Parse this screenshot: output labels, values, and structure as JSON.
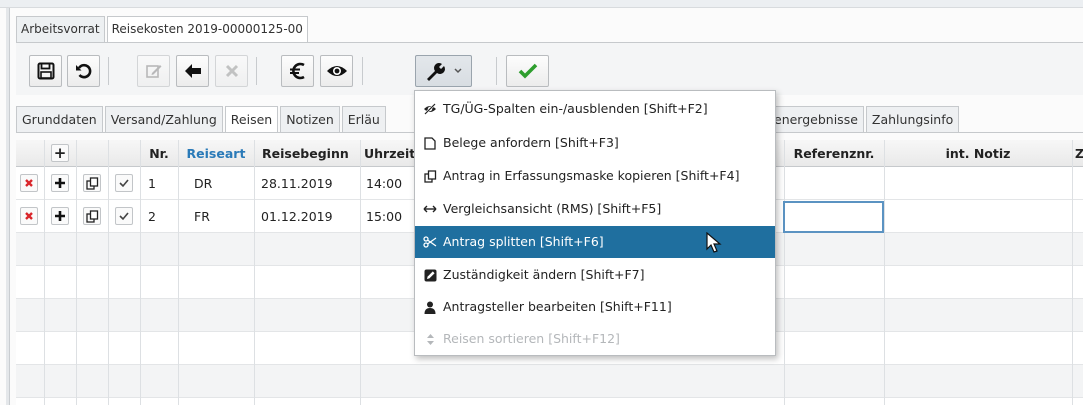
{
  "document_tabs": [
    {
      "label": "Arbeitsvorrat",
      "active": false
    },
    {
      "label": "Reisekosten 2019-00000125-00",
      "active": true
    }
  ],
  "toolbar": {
    "buttons": [
      "save-icon",
      "undo-icon",
      "edit-icon",
      "back-arrow-icon",
      "cancel-icon",
      "euro-icon",
      "eye-icon",
      "wrench-dropdown-icon",
      "confirm-check-icon"
    ],
    "accent_check": "#2e9e2e"
  },
  "detail_tabs": [
    {
      "label": "Grunddaten"
    },
    {
      "label": "Versand/Zahlung"
    },
    {
      "label": "Reisen",
      "active": true
    },
    {
      "label": "Notizen"
    },
    {
      "label": "Erläu"
    },
    {
      "label": "energebnisse"
    },
    {
      "label": "Zahlungsinfo"
    }
  ],
  "grid": {
    "headers": {
      "add": "+",
      "nr": "Nr.",
      "reiseart": "Reiseart",
      "reisebeginn": "Reisebeginn",
      "uhrzeit": "Uhrzeit",
      "referenznr": "Referenznr.",
      "int_notiz": "int. Notiz",
      "last": "Z"
    },
    "header_link_color": "#2a7ab8",
    "rows": [
      {
        "nr": "1",
        "reiseart": "DR",
        "reisebeginn": "28.11.2019",
        "uhrzeit": "14:00"
      },
      {
        "nr": "2",
        "reiseart": "FR",
        "reisebeginn": "01.12.2019",
        "uhrzeit": "15:00"
      }
    ]
  },
  "menu": {
    "items": [
      {
        "label": "TG/ÜG-Spalten ein-/ausblenden [Shift+F2]",
        "icon": "eye-slash-icon"
      },
      {
        "label": "Belege anfordern [Shift+F3]",
        "icon": "document-icon"
      },
      {
        "label": "Antrag in Erfassungsmaske kopieren [Shift+F4]",
        "icon": "copy-icon"
      },
      {
        "label": "Vergleichsansicht (RMS) [Shift+F5]",
        "icon": "arrows-horizontal-icon"
      },
      {
        "label": "Antrag splitten [Shift+F6]",
        "icon": "scissors-icon",
        "highlighted": true
      },
      {
        "label": "Zuständigkeit ändern [Shift+F7]",
        "icon": "edit-square-icon"
      },
      {
        "label": "Antragsteller bearbeiten [Shift+F11]",
        "icon": "user-icon"
      },
      {
        "label": "Reisen sortieren [Shift+F12]",
        "icon": "sort-icon",
        "disabled": true
      }
    ],
    "highlight_color": "#1f6f9f"
  }
}
